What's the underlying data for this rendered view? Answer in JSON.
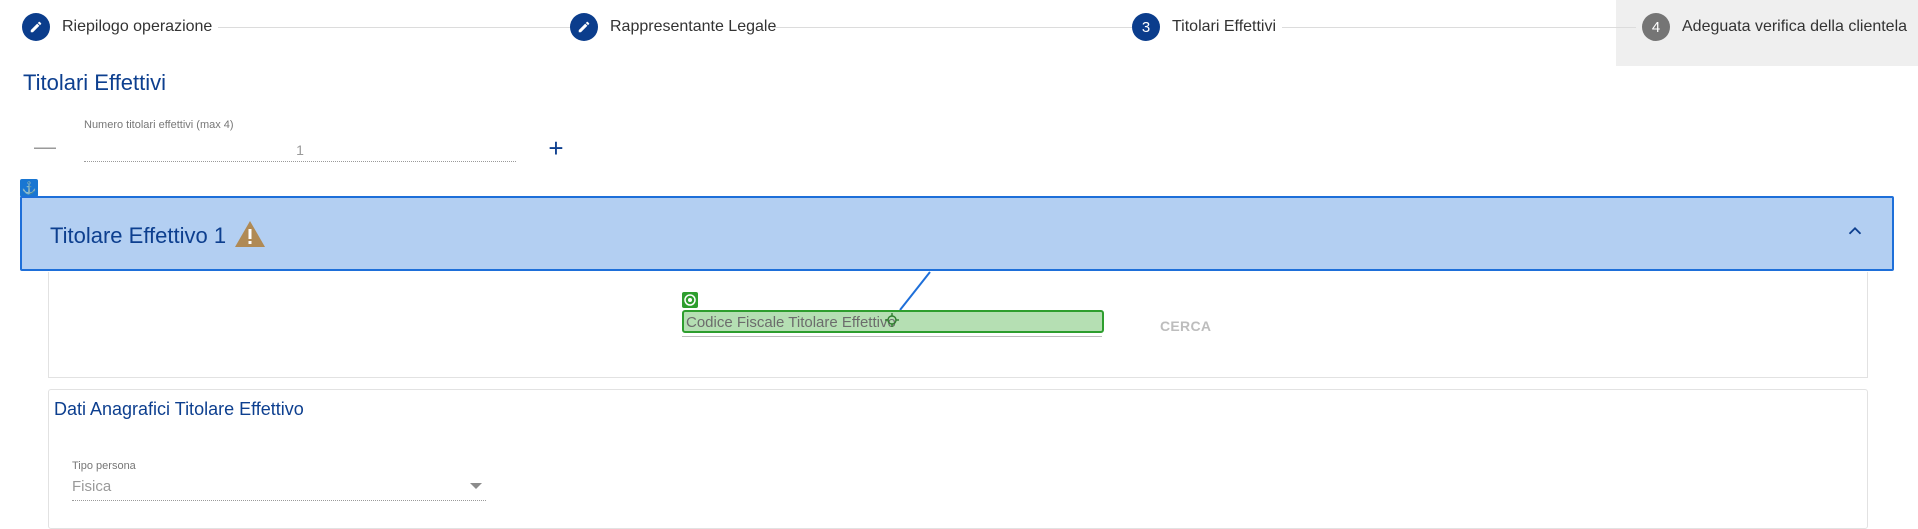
{
  "stepper": {
    "steps": [
      {
        "label": "Riepilogo operazione",
        "marker": "pencil-icon"
      },
      {
        "label": "Rappresentante Legale",
        "marker": "pencil-icon"
      },
      {
        "label": "Titolari Effettivi",
        "number": "3"
      },
      {
        "label": "Adeguata verifica della clientela",
        "number": "4"
      }
    ]
  },
  "page": {
    "title": "Titolari Effettivi"
  },
  "counter": {
    "label": "Numero titolari effettivi (max 4)",
    "value": "1",
    "minus_glyph": "—",
    "plus_glyph": "+"
  },
  "panel": {
    "title": "Titolare Effettivo 1",
    "search": {
      "cf_text": "Codice Fiscale Titolare Effettivo",
      "cerca_label": "CERCA"
    },
    "anagrafici": {
      "title": "Dati Anagrafici Titolare Effettivo",
      "tipo_label": "Tipo persona",
      "tipo_value": "Fisica"
    }
  },
  "colors": {
    "primary": "#0d3f8f",
    "header_bg": "#b3cff2",
    "header_border": "#1e6fd9",
    "highlight_green": "#2e9e2e",
    "highlight_green_bg": "#b5dfb3",
    "warning": "#b08a55"
  }
}
